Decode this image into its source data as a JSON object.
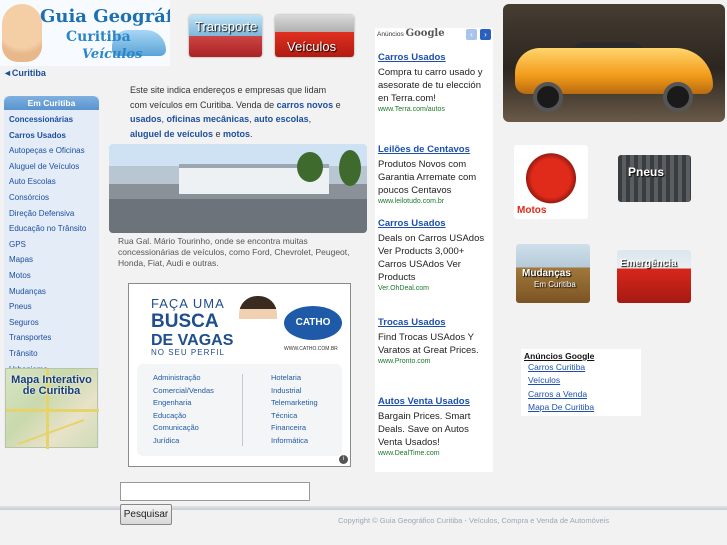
{
  "header": {
    "logo_line1": "Guia Geográfico",
    "logo_line2": "Curitiba",
    "logo_line3": "Veículos",
    "banner_transporte": "Transporte",
    "banner_veiculos": "Veículos"
  },
  "breadcrumb": {
    "label": "◄Curitiba"
  },
  "sidebar": {
    "heading": "Em Curitiba",
    "items": [
      {
        "label": "Concessionárias",
        "bold": true
      },
      {
        "label": "Carros Usados",
        "bold": true
      },
      {
        "label": "Autopeças e Oficinas"
      },
      {
        "label": "Aluguel de Veículos"
      },
      {
        "label": "Auto Escolas"
      },
      {
        "label": "Consórcios"
      },
      {
        "label": "Direção Defensiva"
      },
      {
        "label": "Educação no Trânsito"
      },
      {
        "label": "GPS"
      },
      {
        "label": "Mapas"
      },
      {
        "label": "Motos"
      },
      {
        "label": "Mudanças"
      },
      {
        "label": "Pneus"
      },
      {
        "label": "Seguros"
      },
      {
        "label": "Transportes"
      },
      {
        "label": "Trânsito"
      },
      {
        "label": "Urbanismo"
      }
    ],
    "map_label": "Mapa Interativo de Curitiba"
  },
  "intro": {
    "text_1": "Este site indica endereços e empresas que lidam com veículos em Curitiba. Venda de ",
    "link_1": "carros novos",
    "text_2": " e ",
    "link_2": "usados",
    "text_3": ", ",
    "link_3": "oficinas mecânicas",
    "text_4": ", ",
    "link_4": "auto escolas",
    "text_5": ", ",
    "link_5": "aluguel de veículos",
    "text_6": " e ",
    "link_6": "motos",
    "text_7": "."
  },
  "photo_caption": "Rua Gal. Mário Tourinho, onde se encontra muitas concessionárias de veículos, como Ford, Chevrolet, Peugeot, Honda, Fiat, Audi e outras.",
  "catho_ad": {
    "line1": "FAÇA UMA",
    "line2": "BUSCA",
    "line3": "DE VAGAS",
    "line4": "NO SEU PERFIL",
    "brand": "CATHO",
    "url": "WWW.CATHO.COM.BR",
    "col1": [
      "Administração",
      "Comercial/Vendas",
      "Engenharia",
      "Educação",
      "Comunicação",
      "Jurídica"
    ],
    "col2": [
      "Hotelaria",
      "Industrial",
      "Telemarketing",
      "Técnica",
      "Financeira",
      "Informática"
    ],
    "info": "i"
  },
  "google_ads": {
    "header_text": "Anúncios",
    "header_brand": "Google",
    "prev": "‹",
    "next": "›",
    "ads": [
      {
        "title": "Carros Usados",
        "desc": "Compra tu carro usado y asesorate de tu elección en Terra.com!",
        "url": "www.Terra.com/autos"
      },
      {
        "title": "Leilões de Centavos",
        "desc": "Produtos Novos com Garantia Arremate com poucos Centavos",
        "url": "www.leilotudo.com.br"
      },
      {
        "title": "Carros Usados",
        "desc": "Deals on Carros USAdos Ver Products 3,000+ Carros USAdos Ver Products",
        "url": "Ver.OhDeal.com"
      },
      {
        "title": "Trocas Usados",
        "desc": "Find Trocas USAdos Y Varatos at Great Prices.",
        "url": "www.Pronto.com"
      },
      {
        "title": "Autos Venta Usados",
        "desc": "Bargain Prices. Smart Deals. Save on Autos Venta Usados!",
        "url": "www.DealTime.com"
      }
    ]
  },
  "tiles": {
    "motos": "Motos",
    "pneus": "Pneus",
    "mudancas_1": "Mudanças",
    "mudancas_2": "Em Curitiba",
    "emergencia": "Emergência"
  },
  "google_links": {
    "heading": "Anúncios Google",
    "links": [
      "Carros Curitiba",
      "Veículos",
      "Carros a Venda",
      "Mapa De Curitiba"
    ]
  },
  "search": {
    "value": "",
    "button": "Pesquisar"
  },
  "footer": {
    "copyright": "Copyright © Guia Geográfico Curitiba - Veículos, Compra e Venda de Automóveis"
  }
}
